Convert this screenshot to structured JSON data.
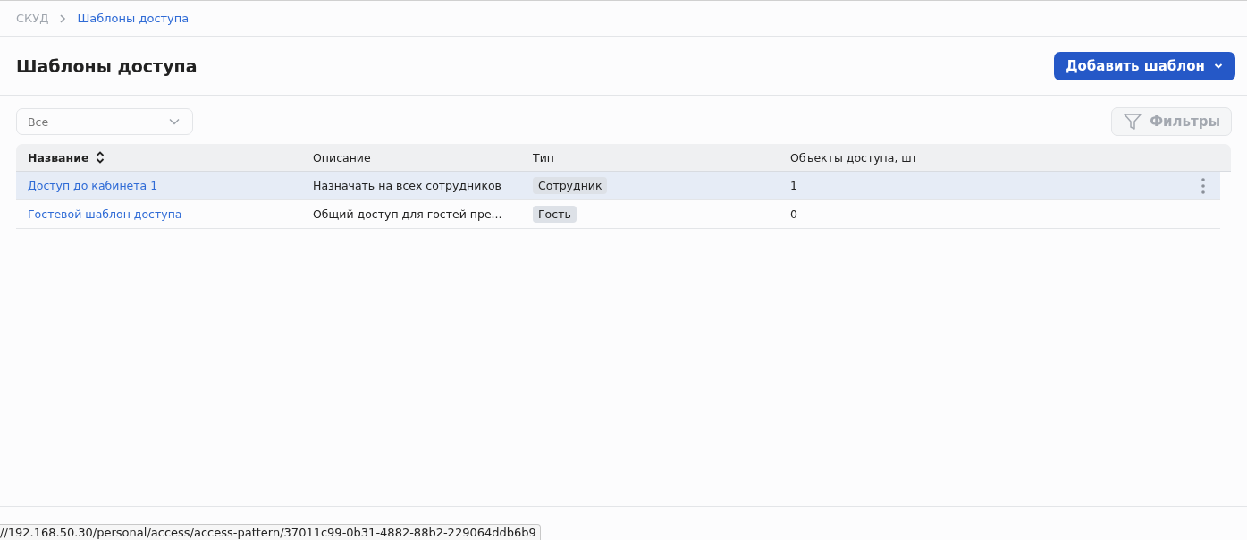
{
  "breadcrumbs": [
    {
      "label": "СКУД",
      "current": false
    },
    {
      "label": "Шаблоны доступа",
      "current": true
    }
  ],
  "title": "Шаблоны доступа",
  "add_button": {
    "label": "Добавить шаблон"
  },
  "select": {
    "value": "Все"
  },
  "filter_button": {
    "label": "Фильтры",
    "disabled": true
  },
  "table": {
    "columns": [
      {
        "label": "Название",
        "sortable": true
      },
      {
        "label": "Описание",
        "sortable": false
      },
      {
        "label": "Тип",
        "sortable": false
      },
      {
        "label": "Объекты доступа, шт",
        "sortable": false
      }
    ],
    "rows": [
      {
        "name": "Доступ до кабинета 1",
        "description": "Назначать на всех сотрудников",
        "type": "Сотрудник",
        "count": "1",
        "selected": true
      },
      {
        "name": "Гостевой шаблон доступа",
        "description": "Общий доступ для гостей пре...",
        "type": "Гость",
        "count": "0",
        "selected": false
      }
    ]
  },
  "status_url": "//192.168.50.30/personal/access/access-pattern/37011c99-0b31-4882-88b2-229064ddb6b9"
}
